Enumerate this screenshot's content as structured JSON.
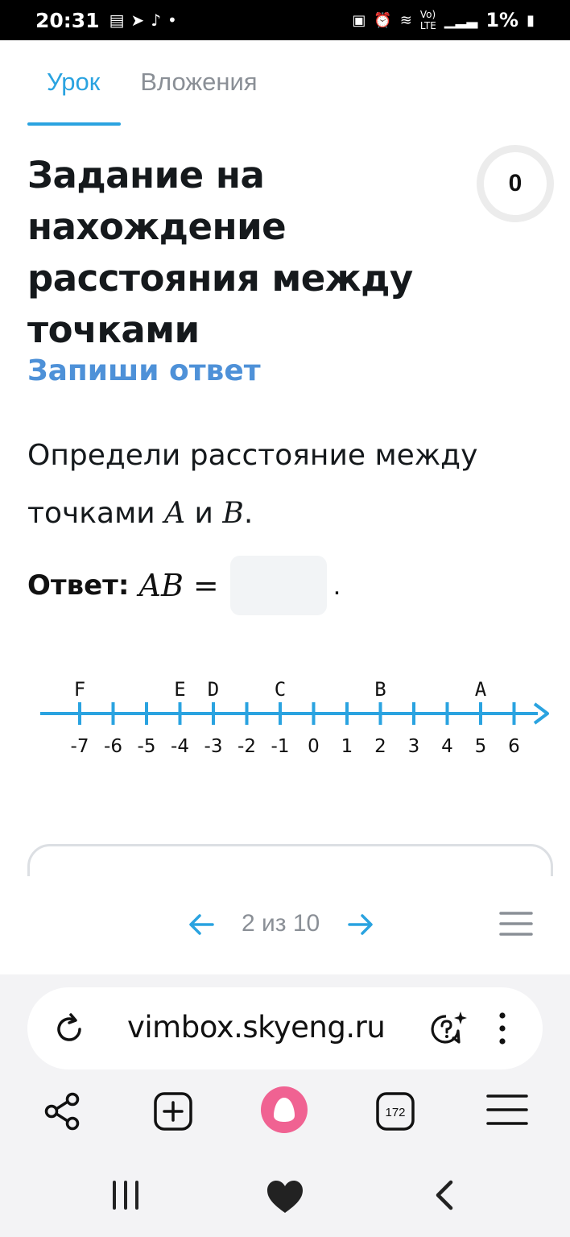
{
  "status_bar": {
    "time": "20:31",
    "battery": "1%"
  },
  "tabs": [
    {
      "label": "Урок",
      "active": true
    },
    {
      "label": "Вложения",
      "active": false
    }
  ],
  "task": {
    "title": "Задание на нахождение расстояния между точками",
    "subtitle": "Запиши ответ",
    "score": "0",
    "question_text": "Определи расстояние между точками",
    "point_a": "A",
    "conj": "и",
    "point_b": "B",
    "period": ".",
    "answer_label": "Ответ:",
    "answer_expr": "AB",
    "answer_eq": "=",
    "answer_value": "",
    "answer_tail": "."
  },
  "number_line": {
    "ticks": [
      "-7",
      "-6",
      "-5",
      "-4",
      "-3",
      "-2",
      "-1",
      "0",
      "1",
      "2",
      "3",
      "4",
      "5",
      "6"
    ],
    "points": [
      {
        "label": "F",
        "value": -7
      },
      {
        "label": "E",
        "value": -4
      },
      {
        "label": "D",
        "value": -3
      },
      {
        "label": "C",
        "value": -1
      },
      {
        "label": "B",
        "value": 2
      },
      {
        "label": "A",
        "value": 5
      }
    ],
    "color": "#2aa3e0"
  },
  "pager": {
    "text": "2 из 10"
  },
  "browser": {
    "url": "vimbox.skyeng.ru",
    "tabs_count": "172"
  },
  "colors": {
    "accent": "#2aa3e0",
    "subtitle": "#4e91d8",
    "alice": "#f06292"
  }
}
